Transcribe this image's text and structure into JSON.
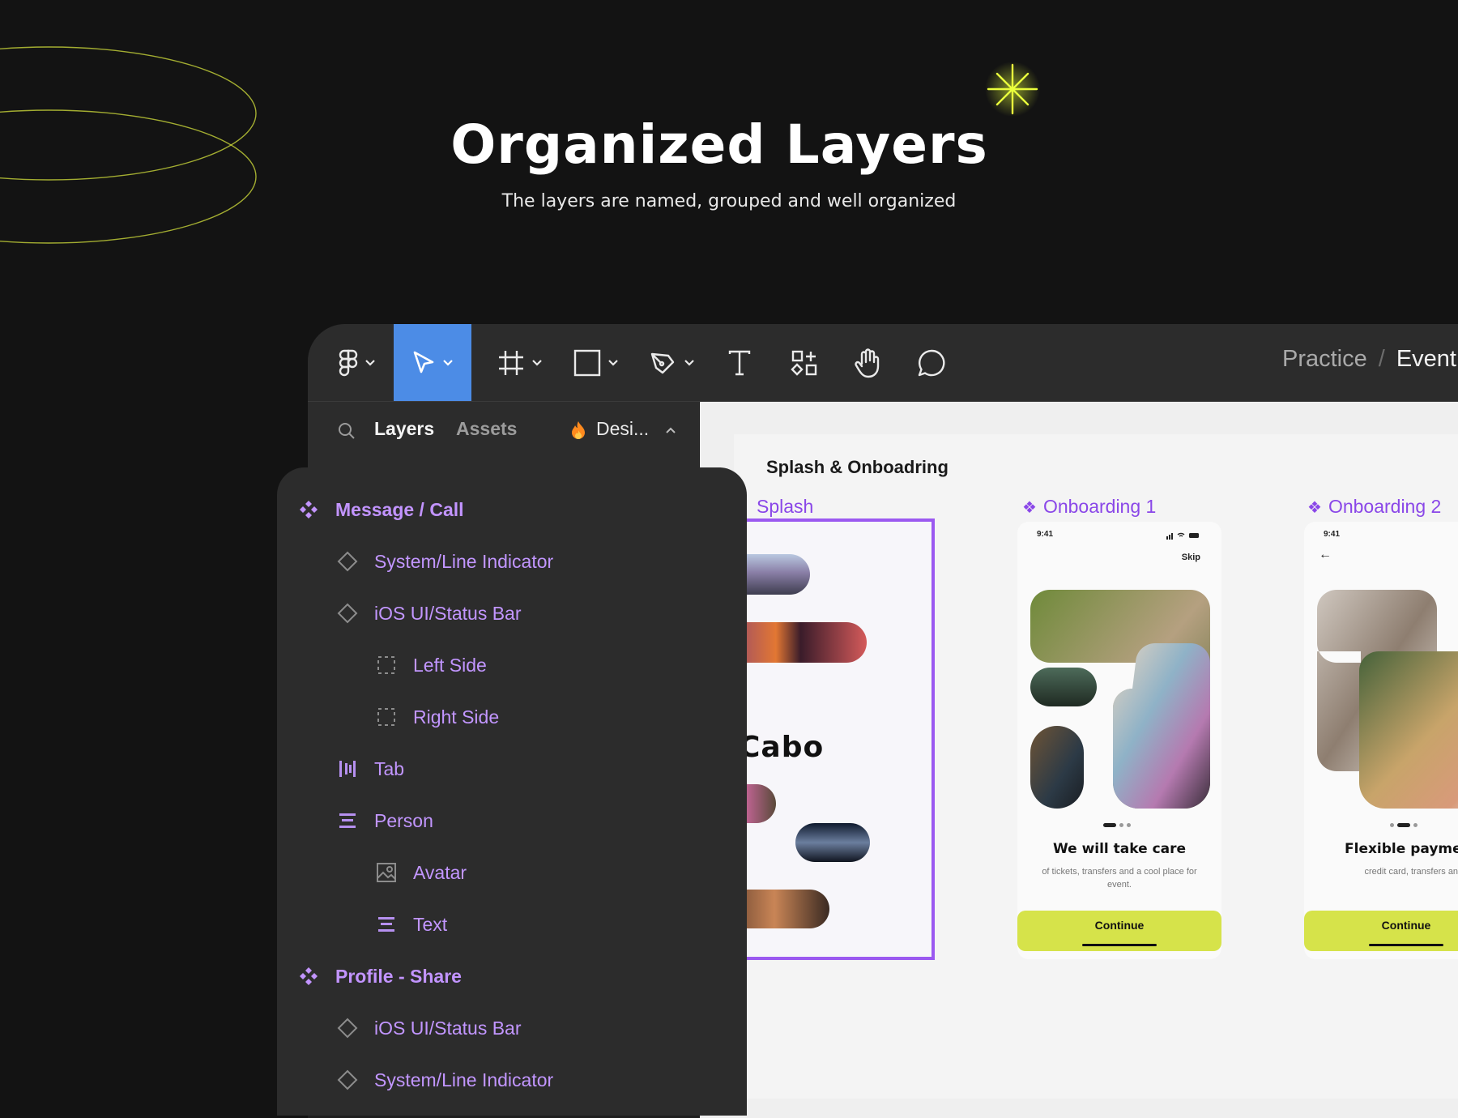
{
  "hero": {
    "title": "Organized Layers",
    "subtitle": "The layers are named, grouped and well organized"
  },
  "colors": {
    "background": "#131313",
    "accent_lime": "#d6e34a",
    "toolbar_active": "#4c8ce6",
    "component_purple": "#9b59f0",
    "layer_text": "#c296ff"
  },
  "toolbar": {
    "tools": [
      {
        "name": "figma-menu",
        "icon": "figma-logo-icon",
        "has_dropdown": true
      },
      {
        "name": "move",
        "icon": "cursor-icon",
        "has_dropdown": true,
        "active": true
      },
      {
        "name": "frame",
        "icon": "frame-icon",
        "has_dropdown": true
      },
      {
        "name": "shape",
        "icon": "rectangle-icon",
        "has_dropdown": true
      },
      {
        "name": "pen",
        "icon": "pen-icon",
        "has_dropdown": true
      },
      {
        "name": "text",
        "icon": "text-icon",
        "has_dropdown": false
      },
      {
        "name": "resources",
        "icon": "resources-icon",
        "has_dropdown": false
      },
      {
        "name": "hand",
        "icon": "hand-icon",
        "has_dropdown": false
      },
      {
        "name": "comment",
        "icon": "comment-icon",
        "has_dropdown": false
      }
    ],
    "breadcrumb_project": "Practice",
    "breadcrumb_separator": "/",
    "breadcrumb_file": "Event"
  },
  "panel": {
    "tab_layers": "Layers",
    "tab_assets": "Assets",
    "page_name": "Desi..."
  },
  "layers": [
    {
      "label": "Message / Call",
      "icon": "component-icon",
      "type": "component"
    },
    {
      "label": "System/Line Indicator",
      "icon": "instance-icon",
      "type": "instance"
    },
    {
      "label": "iOS UI/Status Bar",
      "icon": "instance-icon",
      "type": "instance"
    },
    {
      "label": "Left Side",
      "icon": "frame-dashed-icon",
      "type": "frame"
    },
    {
      "label": "Right Side",
      "icon": "frame-dashed-icon",
      "type": "frame"
    },
    {
      "label": "Tab",
      "icon": "autolayout-horizontal-icon",
      "type": "autolayout"
    },
    {
      "label": "Person",
      "icon": "autolayout-vertical-icon",
      "type": "autolayout"
    },
    {
      "label": "Avatar",
      "icon": "image-icon",
      "type": "image"
    },
    {
      "label": "Text",
      "icon": "autolayout-vertical-icon",
      "type": "autolayout"
    },
    {
      "label": "Profile - Share",
      "icon": "component-icon",
      "type": "component"
    },
    {
      "label": "iOS UI/Status Bar",
      "icon": "instance-icon",
      "type": "instance"
    },
    {
      "label": "System/Line Indicator",
      "icon": "instance-icon",
      "type": "instance"
    }
  ],
  "canvas": {
    "section_title": "Splash & Onboadring",
    "frames": [
      {
        "label": "Splash",
        "logo": "Cabo"
      },
      {
        "label": "Onboarding 1",
        "time": "9:41",
        "skip": "Skip",
        "title": "We will take care",
        "description": "of tickets, transfers and a cool place for event.",
        "button": "Continue"
      },
      {
        "label": "Onboarding 2",
        "time": "9:41",
        "back": "←",
        "title": "Flexible payme",
        "description": "credit card, transfers an cryptocurrency.",
        "button": "Continue"
      }
    ]
  }
}
